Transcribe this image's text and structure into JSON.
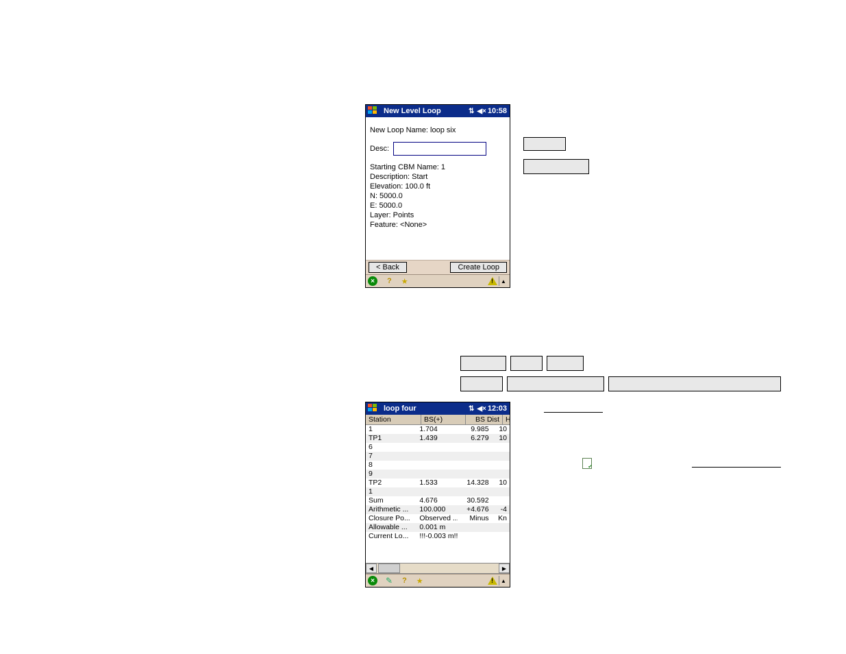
{
  "screen1": {
    "title": "New Level Loop",
    "time": "10:58",
    "loop_name_label": "New Loop Name: loop six",
    "desc_label": "Desc:",
    "desc_value": "",
    "info": {
      "l1": "Starting CBM Name: 1",
      "l2": " Description: Start",
      "l3": " Elevation: 100.0 ft",
      "l4": " N: 5000.0",
      "l5": " E: 5000.0",
      "l6": "Layer: Points",
      "l7": "Feature: <None>"
    },
    "back_btn": "< Back",
    "create_btn": "Create Loop"
  },
  "screen2": {
    "title": "loop four",
    "time": "12:03",
    "cols": {
      "station": "Station",
      "bs": "BS(+)",
      "bsdist": "BS Dist",
      "hi": "HI"
    },
    "rows": [
      {
        "station": "1",
        "bs": "1.704",
        "bsdist": "9.985",
        "hi": "10"
      },
      {
        "station": "TP1",
        "bs": "1.439",
        "bsdist": "6.279",
        "hi": "10"
      },
      {
        "station": "6",
        "bs": "",
        "bsdist": "",
        "hi": ""
      },
      {
        "station": "7",
        "bs": "",
        "bsdist": "",
        "hi": ""
      },
      {
        "station": "8",
        "bs": "",
        "bsdist": "",
        "hi": ""
      },
      {
        "station": "9",
        "bs": "",
        "bsdist": "",
        "hi": ""
      },
      {
        "station": "TP2",
        "bs": "1.533",
        "bsdist": "14.328",
        "hi": "10"
      },
      {
        "station": "1",
        "bs": "",
        "bsdist": "",
        "hi": ""
      },
      {
        "station": "Sum",
        "bs": "4.676",
        "bsdist": "30.592",
        "hi": ""
      },
      {
        "station": "Arithmetic ...",
        "bs": "100.000",
        "bsdist": "+4.676",
        "hi": "-4"
      },
      {
        "station": "Closure Po...",
        "bs": "Observed ...",
        "bsdist": "Minus",
        "hi": "Kn"
      },
      {
        "station": "Allowable ...",
        "bs": "0.001 m",
        "bsdist": "",
        "hi": ""
      },
      {
        "station": "Current Lo...",
        "bs": "!!!-0.003 m!!!",
        "bsdist": "",
        "hi": ""
      }
    ]
  }
}
